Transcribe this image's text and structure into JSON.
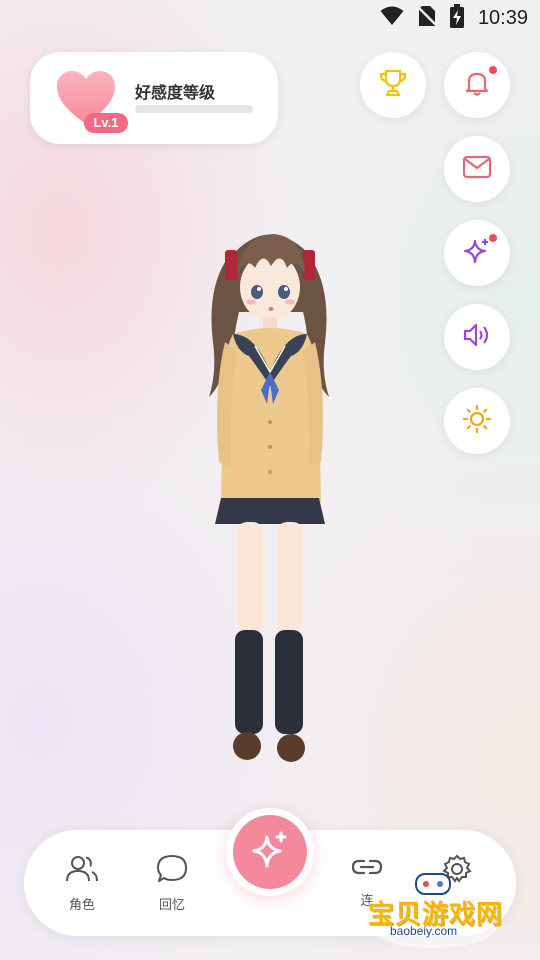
{
  "status_bar": {
    "time": "10:39"
  },
  "affinity": {
    "title": "好感度等级",
    "level": "Lv.1",
    "progress": 0.0
  },
  "side_buttons": [
    {
      "name": "trophy",
      "icon": "trophy-icon",
      "color": "#f2c200",
      "has_dot": false
    },
    {
      "name": "notifications",
      "icon": "bell-icon",
      "color": "#f06474",
      "has_dot": true
    },
    {
      "name": "mail",
      "icon": "mail-icon",
      "color": "#e4667f",
      "has_dot": false
    },
    {
      "name": "sparkle",
      "icon": "sparkle-icon",
      "color": "#9a48d0",
      "has_dot": true
    },
    {
      "name": "sound",
      "icon": "speaker-icon",
      "color": "#9a48d0",
      "has_dot": false
    },
    {
      "name": "brightness",
      "icon": "sun-icon",
      "color": "#f2a516",
      "has_dot": false
    }
  ],
  "bottom_nav": {
    "items": [
      {
        "label": "角色",
        "icon": "users-icon"
      },
      {
        "label": "回忆",
        "icon": "chat-bubble-icon"
      },
      {
        "label": "连",
        "icon": "link-icon"
      },
      {
        "label": "",
        "icon": "gear-icon"
      }
    ],
    "center_icon": "sparkle-icon",
    "accent": "#f4899c"
  },
  "watermark": {
    "text": "宝贝游戏网",
    "url": "baobeiy.com"
  }
}
